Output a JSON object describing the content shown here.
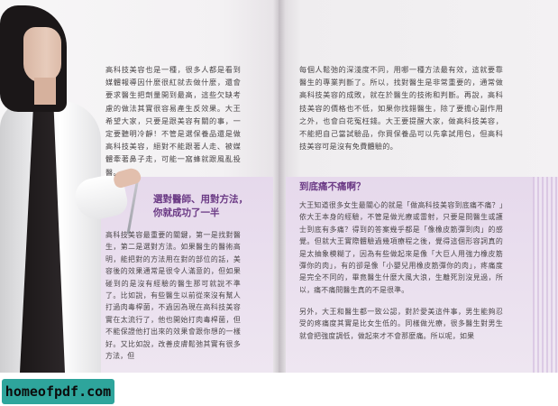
{
  "left_page": {
    "paragraph_top": "高科技美容也是一種，很多人都是看到媒體報導因什麼很紅就去做什麼，還會要求醫生把劑量開到最高，這些欠缺考慮的做法其實很容易產生反效果。大王希望大家，只要是跟美容有關的事，一定要聽明冷靜！不管是選保養品還是做高科技美容，絕對不能跟著人走、被媒體牽著鼻子走，可能一窩蜂就跟風亂投醫。",
    "heading_line1": "選對醫師、用對方法，",
    "heading_line2": "你就成功了一半",
    "paragraph_bottom": "高科技美容最重要的關鍵，第一是找對醫生，第二是選對方法。如果醫生的醫術高明，能把對的方法用在對的部位的話，美容後的效果通常是很令人滿意的，但如果碰到的是沒有經驗的醫生那可就說不準了。比如說，有些醫生以前從來沒有幫人打過肉毒桿菌，不過因為現在高科技美容實在太流行了，他也開始打肉毒桿菌，但不能保證他打出來的效果會跟你想的一樣好。又比如說，改善皮膚鬆弛其實有很多方法，但"
  },
  "right_page": {
    "paragraph_top": "每個人鬆弛的深淺度不同，用哪一種方法最有效，這就要靠醫生的專業判斷了。所以，找對醫生是非常重要的，通常做高科技美容的成敗，就在於醫生的技術和判斷。再說，高科技美容的價格也不低，如果你找錯醫生，除了要擔心副作用之外，也會白花冤枉錢。大王要提醒大家，做高科技美容，不能把自己當試驗品，你買保養品可以先拿試用包，但高科技美容可是沒有免費體驗的。",
    "heading": "到底痛不痛啊？",
    "paragraph_bottom_1": "大王知道很多女生最關心的就是「做高科技美容到底痛不痛？」依大王本身的經驗，不管是做光療或雷射，只要是問醫生或護士到底有多痛？得到的答案幾乎都是「像橡皮筋彈到肉」的感覺。但就大王實際體驗過幾項療程之後，覺得這個形容詞真的是太抽象模糊了，因為有些做起來是像「大巨人用強力橡皮筋彈你的肉」，有的卻是像「小嬰兒用橡皮筋彈你的肉」，疼痛度是完全不同的，畢竟醫生什麼大風大浪，生離死別沒見過，所以，痛不痛問醫生真的不是很準。",
    "paragraph_bottom_2": "另外，大王和醫生都一致公認，對於愛美這件事，男生能夠忍受的疼痛度其實是比女生低的。同樣做光療，很多醫生對男生就會把強度調低，做起來才不會那麼痛。所以呢，如果"
  },
  "footer": {
    "badge_text": "homeofpdf.com"
  },
  "colors": {
    "heading_purple": "#6b3a85",
    "lavender_band": "#e6d9ec",
    "badge_teal": "#2ea59c"
  }
}
